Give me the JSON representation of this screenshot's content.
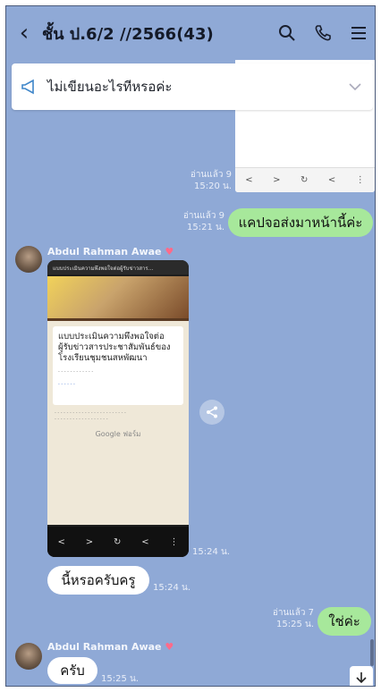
{
  "header": {
    "title": "ชั้น ป.6/2 //2566(43)"
  },
  "announcement": {
    "text": "ไม่เขียนอะไรทีหรอค่ะ"
  },
  "messages": {
    "m1": {
      "read": "อ่านแล้ว 9",
      "time": "15:20 น."
    },
    "m2": {
      "read": "อ่านแล้ว 9",
      "time": "15:21 น.",
      "text": "แคปจอส่งมาหน้านี้ค่ะ"
    },
    "sender1": {
      "name": "Abdul Rahman  Awae"
    },
    "form": {
      "topbar": "แบบประเมินความพึงพอใจต่อผู้รับข่าวสาร...",
      "title": "แบบประเมินความพึงพอใจต่อผู้รับข่าวสารประชาสัมพันธ์ของโรงเรียนชุมชนสหพัฒนา",
      "google": "Google ฟอร์ม",
      "time": "15:24 น."
    },
    "m3": {
      "text": "นี้หรอครับครู",
      "time": "15:24 น."
    },
    "m4": {
      "read": "อ่านแล้ว 7",
      "time": "15:25 น.",
      "text": "ใช่ค่ะ"
    },
    "sender2": {
      "name": "Abdul Rahman  Awae"
    },
    "m5": {
      "text": "ครับ",
      "time": "15:25 น."
    }
  }
}
